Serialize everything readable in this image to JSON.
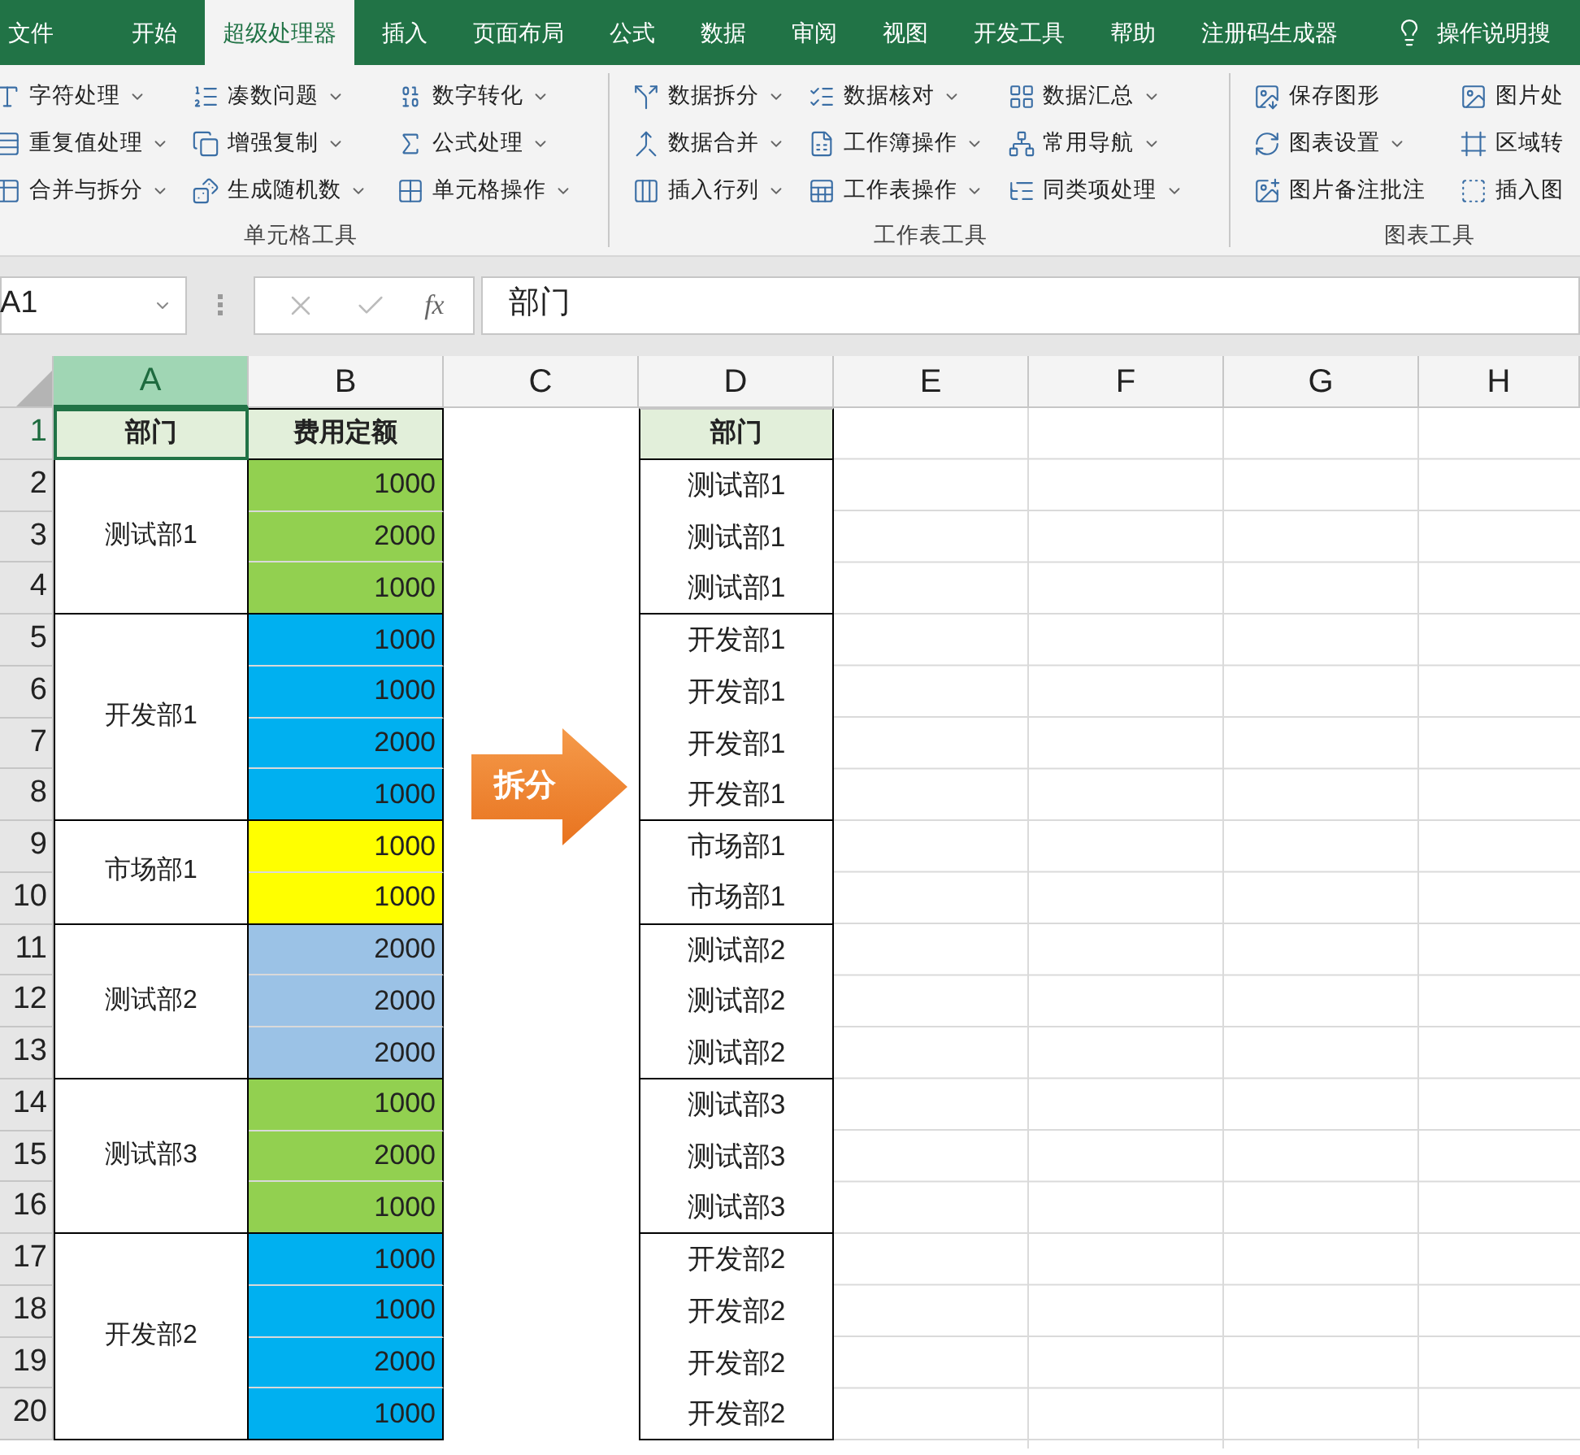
{
  "tabs": [
    {
      "label": "文件",
      "selected": false
    },
    {
      "label": "开始",
      "selected": false
    },
    {
      "label": "超级处理器",
      "selected": true
    },
    {
      "label": "插入",
      "selected": false
    },
    {
      "label": "页面布局",
      "selected": false
    },
    {
      "label": "公式",
      "selected": false
    },
    {
      "label": "数据",
      "selected": false
    },
    {
      "label": "审阅",
      "selected": false
    },
    {
      "label": "视图",
      "selected": false
    },
    {
      "label": "开发工具",
      "selected": false
    },
    {
      "label": "帮助",
      "selected": false
    },
    {
      "label": "注册码生成器",
      "selected": false
    }
  ],
  "search_label": "操作说明搜",
  "ribbon_groups": [
    {
      "label": "单元格工具",
      "columns": [
        [
          {
            "label": "字符处理",
            "dropdown": true
          },
          {
            "label": "重复值处理",
            "dropdown": true
          },
          {
            "label": "合并与拆分",
            "dropdown": true
          }
        ],
        [
          {
            "label": "凑数问题",
            "dropdown": true
          },
          {
            "label": "增强复制",
            "dropdown": true
          },
          {
            "label": "生成随机数",
            "dropdown": true
          }
        ],
        [
          {
            "label": "数字转化",
            "dropdown": true
          },
          {
            "label": "公式处理",
            "dropdown": true
          },
          {
            "label": "单元格操作",
            "dropdown": true
          }
        ]
      ]
    },
    {
      "label": "工作表工具",
      "columns": [
        [
          {
            "label": "数据拆分",
            "dropdown": true
          },
          {
            "label": "数据合并",
            "dropdown": true
          },
          {
            "label": "插入行列",
            "dropdown": true
          }
        ],
        [
          {
            "label": "数据核对",
            "dropdown": true
          },
          {
            "label": "工作簿操作",
            "dropdown": true
          },
          {
            "label": "工作表操作",
            "dropdown": true
          }
        ],
        [
          {
            "label": "数据汇总",
            "dropdown": true
          },
          {
            "label": "常用导航",
            "dropdown": true
          },
          {
            "label": "同类项处理",
            "dropdown": true
          }
        ]
      ]
    },
    {
      "label": "图表工具",
      "columns": [
        [
          {
            "label": "保存图形",
            "dropdown": false
          },
          {
            "label": "图表设置",
            "dropdown": true
          },
          {
            "label": "图片备注批注",
            "dropdown": false
          }
        ],
        [
          {
            "label": "图片处",
            "dropdown": false
          },
          {
            "label": "区域转",
            "dropdown": false
          },
          {
            "label": "插入图",
            "dropdown": false
          }
        ]
      ]
    }
  ],
  "formula_bar": {
    "name_box": "A1",
    "function_label": "fx",
    "value": "部门"
  },
  "column_headers": [
    {
      "label": "A",
      "selected": true
    },
    {
      "label": "B",
      "selected": false
    },
    {
      "label": "C",
      "selected": false
    },
    {
      "label": "D",
      "selected": false
    },
    {
      "label": "E",
      "selected": false
    },
    {
      "label": "F",
      "selected": false
    },
    {
      "label": "G",
      "selected": false
    },
    {
      "label": "H",
      "selected": false
    }
  ],
  "row_headers": [
    "1",
    "2",
    "3",
    "4",
    "5",
    "6",
    "7",
    "8",
    "9",
    "10",
    "11",
    "12",
    "13",
    "14",
    "15",
    "16",
    "17",
    "18",
    "19",
    "20"
  ],
  "source_table": {
    "headers": [
      "部门",
      "费用定额"
    ],
    "groups": [
      {
        "department": "测试部1",
        "amounts": [
          {
            "value": "1000",
            "color": "#92d050"
          },
          {
            "value": "2000",
            "color": "#92d050"
          },
          {
            "value": "1000",
            "color": "#92d050"
          }
        ]
      },
      {
        "department": "开发部1",
        "amounts": [
          {
            "value": "1000",
            "color": "#00b0f0"
          },
          {
            "value": "1000",
            "color": "#00b0f0"
          },
          {
            "value": "2000",
            "color": "#00b0f0"
          },
          {
            "value": "1000",
            "color": "#00b0f0"
          }
        ]
      },
      {
        "department": "市场部1",
        "amounts": [
          {
            "value": "1000",
            "color": "#ffff00"
          },
          {
            "value": "1000",
            "color": "#ffff00"
          }
        ]
      },
      {
        "department": "测试部2",
        "amounts": [
          {
            "value": "2000",
            "color": "#9bc2e6"
          },
          {
            "value": "2000",
            "color": "#9bc2e6"
          },
          {
            "value": "2000",
            "color": "#9bc2e6"
          }
        ]
      },
      {
        "department": "测试部3",
        "amounts": [
          {
            "value": "1000",
            "color": "#92d050"
          },
          {
            "value": "2000",
            "color": "#92d050"
          },
          {
            "value": "1000",
            "color": "#92d050"
          }
        ]
      },
      {
        "department": "开发部2",
        "amounts": [
          {
            "value": "1000",
            "color": "#00b0f0"
          },
          {
            "value": "1000",
            "color": "#00b0f0"
          },
          {
            "value": "2000",
            "color": "#00b0f0"
          },
          {
            "value": "1000",
            "color": "#00b0f0"
          }
        ]
      }
    ]
  },
  "arrow_label": "拆分",
  "result_table": {
    "header": "部门",
    "groups": [
      [
        "测试部1",
        "测试部1",
        "测试部1"
      ],
      [
        "开发部1",
        "开发部1",
        "开发部1",
        "开发部1"
      ],
      [
        "市场部1",
        "市场部1"
      ],
      [
        "测试部2",
        "测试部2",
        "测试部2"
      ],
      [
        "测试部3",
        "测试部3",
        "测试部3"
      ],
      [
        "开发部2",
        "开发部2",
        "开发部2",
        "开发部2"
      ]
    ]
  }
}
